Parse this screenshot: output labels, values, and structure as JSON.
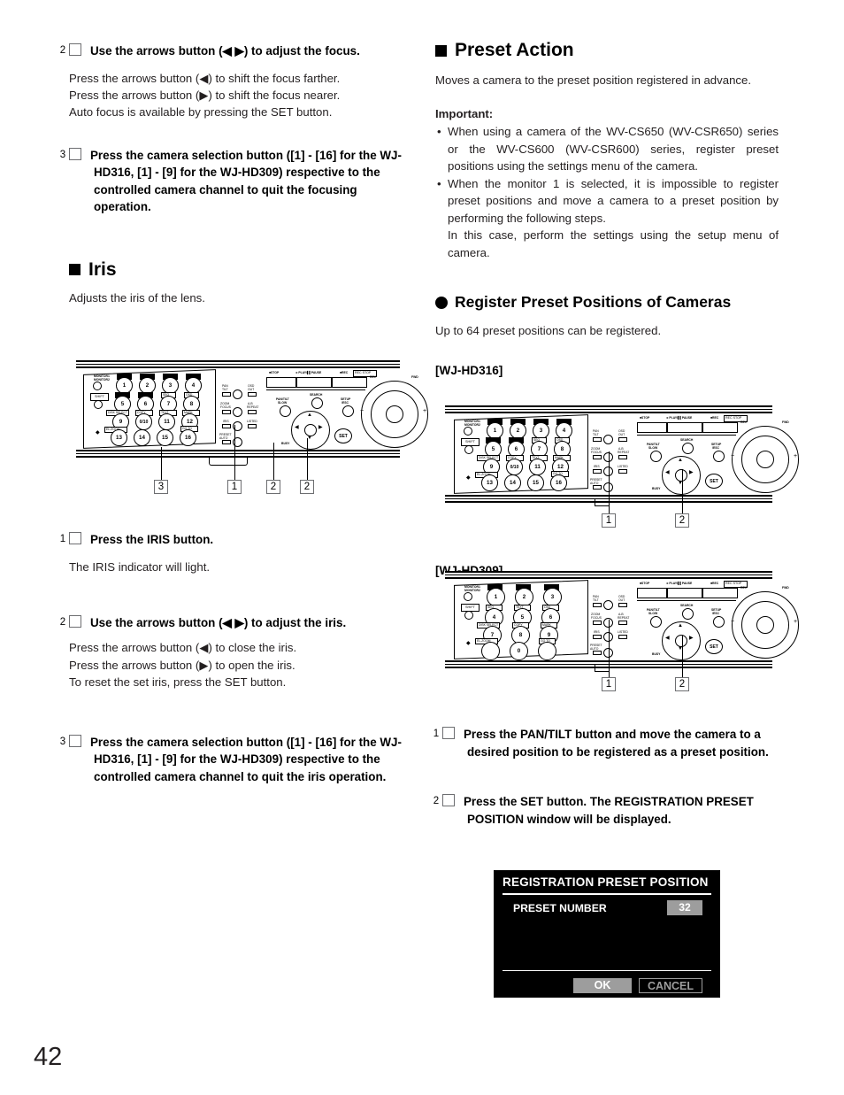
{
  "page": {
    "number": "42"
  },
  "left_column": {
    "step2_focus": {
      "num": "2",
      "heading": "Use the arrows button (◀ ▶) to adjust the focus.",
      "lines": [
        "Press the arrows button (◀) to shift the focus farther.",
        "Press the arrows button (▶) to shift the focus nearer.",
        "Auto focus is available by pressing the SET button."
      ]
    },
    "step3_focus": {
      "num": "3",
      "heading": "Press the camera selection button ([1] - [16] for the WJ-HD316, [1] - [9] for the WJ-HD309) respective to the controlled camera channel to quit the focusing operation."
    },
    "iris_heading": "Iris",
    "iris_intro": "Adjusts the iris of the lens.",
    "step1_iris": {
      "num": "1",
      "heading": "Press the IRIS button.",
      "lines": [
        "The IRIS indicator will light."
      ]
    },
    "step2_iris": {
      "num": "2",
      "heading": "Use the arrows button (◀ ▶) to adjust the iris.",
      "lines": [
        "Press the arrows button (◀) to close the iris.",
        "Press the arrows button (▶) to open the iris.",
        "To reset the set iris, press the SET button."
      ]
    },
    "step3_iris": {
      "num": "3",
      "heading": "Press the camera selection button ([1] - [16] for the WJ-HD316, [1] - [9] for the WJ-HD309) respective to the controlled camera channel to quit the iris operation."
    },
    "diagram_callouts": [
      "3",
      "1",
      "2",
      "2"
    ]
  },
  "right_column": {
    "preset_action_heading": "Preset Action",
    "preset_action_intro": "Moves a camera to the preset position registered in advance.",
    "important_label": "Important:",
    "important_bullets": [
      "When using a camera of the WV-CS650 (WV-CSR650) series or the WV-CS600 (WV-CSR600) series, register preset positions using the settings menu of the camera.",
      "When the monitor 1 is selected, it is impossible to register preset positions and move a camera to a preset position by performing the following steps."
    ],
    "important_extra": "In this case, perform the settings using the setup menu of camera.",
    "register_heading": "Register Preset Positions of Cameras",
    "register_intro": "Up to 64 preset positions can be registered.",
    "model_hd316": "[WJ-HD316]",
    "model_hd309": "[WJ-HD309]",
    "diagram_callouts_hd316": [
      "1",
      "2"
    ],
    "diagram_callouts_hd309": [
      "1",
      "2"
    ],
    "step1_preset": {
      "num": "1",
      "heading": "Press the PAN/TILT button and move the camera to a desired position to be registered as a preset position."
    },
    "step2_preset": {
      "num": "2",
      "heading": "Press the SET button. The REGISTRATION PRESET POSITION window will be displayed."
    }
  },
  "osd_dialog": {
    "title": "REGISTRATION PRESET POSITION",
    "preset_number_label": "PRESET NUMBER",
    "preset_number_value": "32",
    "ok_label": "OK",
    "cancel_label": "CANCEL",
    "colors": {
      "background": "#000000",
      "foreground": "#ffffff",
      "highlight": "#9d9d9d"
    }
  },
  "panel_labels": {
    "monitor": "MONITOR1\nMONITOR2",
    "shift": "SHIFT",
    "stop": "STOP",
    "play_pause": "PLAY/PAUSE",
    "rec": "REC",
    "rec_stop": "REC STOP",
    "rev": "REV",
    "fwd": "FWD",
    "search": "SEARCH",
    "pantilt_slow": "PAN/TILT SLOW",
    "setup_esc": "SETUP/ESC",
    "set": "SET",
    "busy": "BUSY",
    "zoom_focus": "ZOOM FOCUS",
    "iris": "IRIS",
    "preset_auto": "PRESET AUTO",
    "pan_tilt": "PAN TILT",
    "osd_out": "OSD OUT",
    "ab_repeat": "A-B REPEAT",
    "listed": "LISTED",
    "keys_hd316": [
      "1",
      "2",
      "3",
      "4",
      "5",
      "6",
      "7",
      "8",
      "9",
      "0/10",
      "11",
      "12",
      "13",
      "14",
      "15",
      "16"
    ],
    "keys_hd309": [
      "1",
      "2",
      "3",
      "4",
      "5",
      "6",
      "7",
      "8",
      "9",
      "0"
    ],
    "key_tags_hd316": [
      "",
      "",
      "",
      "",
      "",
      "",
      "SEQ",
      "OSD",
      "DISK SELECT",
      "COPY",
      "TEXT",
      "MARK",
      "EL-ZOOM",
      "",
      "",
      "GO TO"
    ],
    "key_tags_hd309": [
      "",
      "",
      "",
      "SEQ",
      "TEXT",
      "OSD",
      "DISK SELECT",
      "COPY",
      "MARK",
      "EL-ZOOM",
      "GO TO"
    ]
  }
}
